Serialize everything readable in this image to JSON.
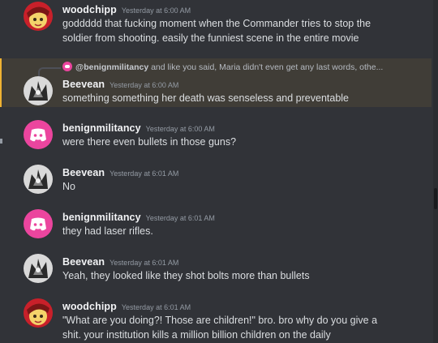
{
  "messages": [
    {
      "author": "woodchipp",
      "timestamp": "Yesterday at 6:00 AM",
      "lines": [
        "goddddd that fucking moment when the Commander tries to stop the",
        "soldier from shooting. easily the funniest scene in the entire movie"
      ]
    },
    {
      "reply_to": {
        "author": "@benignmilitancy",
        "preview": "and like you said, Maria didn't even get any last words, othe..."
      },
      "author": "Beevean",
      "timestamp": "Yesterday at 6:00 AM",
      "lines": [
        "something something her death was senseless and preventable"
      ]
    },
    {
      "author": "benignmilitancy",
      "timestamp": "Yesterday at 6:00 AM",
      "lines": [
        "were there even bullets in those guns?"
      ]
    },
    {
      "author": "Beevean",
      "timestamp": "Yesterday at 6:01 AM",
      "lines": [
        "No"
      ]
    },
    {
      "author": "benignmilitancy",
      "timestamp": "Yesterday at 6:01 AM",
      "lines": [
        "they had laser rifles."
      ]
    },
    {
      "author": "Beevean",
      "timestamp": "Yesterday at 6:01 AM",
      "lines": [
        "Yeah, they looked like they shot bolts more than bullets"
      ]
    },
    {
      "author": "woodchipp",
      "timestamp": "Yesterday at 6:01 AM",
      "lines": [
        "\"What are you doing?! Those are children!\" bro. bro why do you give a",
        "shit. your institution kills a million billion children on the daily"
      ]
    }
  ],
  "colors": {
    "background": "#313338",
    "mention_highlight": "#f0b232",
    "discord_pink": "#eb459e",
    "username": "#f2f3f5",
    "timestamp": "#949ba4"
  },
  "icons": {
    "woodchipp_avatar": "red-yellow-anime-avatar",
    "beevean_avatar": "grey-sketch-avatar",
    "benignmilitancy_avatar": "discord-logo-pink-avatar"
  }
}
